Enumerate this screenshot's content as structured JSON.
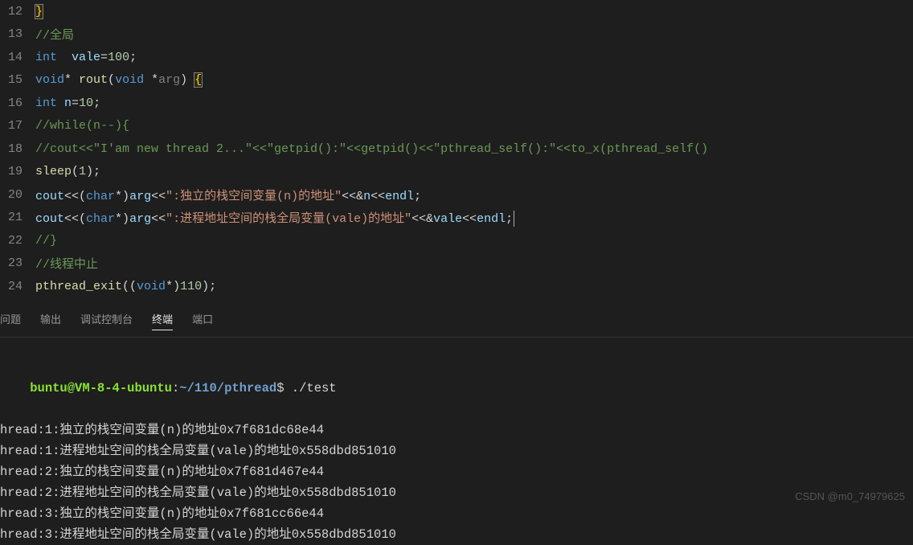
{
  "editor": {
    "lines": [
      {
        "num": "12",
        "tokens": [
          {
            "t": "}",
            "c": "tk-brace-hl"
          }
        ]
      },
      {
        "num": "13",
        "tokens": [
          {
            "t": "//全局",
            "c": "tk-cmt"
          }
        ]
      },
      {
        "num": "14",
        "tokens": [
          {
            "t": "int",
            "c": "tk-type"
          },
          {
            "t": "  ",
            "c": ""
          },
          {
            "t": "vale",
            "c": "tk-var"
          },
          {
            "t": "=",
            "c": "tk-pun"
          },
          {
            "t": "100",
            "c": "tk-num"
          },
          {
            "t": ";",
            "c": "tk-pun"
          }
        ]
      },
      {
        "num": "15",
        "tokens": [
          {
            "t": "void",
            "c": "tk-type"
          },
          {
            "t": "* ",
            "c": "tk-pun"
          },
          {
            "t": "rout",
            "c": "tk-fn"
          },
          {
            "t": "(",
            "c": "tk-pun"
          },
          {
            "t": "void",
            "c": "tk-type"
          },
          {
            "t": " *",
            "c": "tk-pun"
          },
          {
            "t": "arg",
            "c": "tk-param"
          },
          {
            "t": ") ",
            "c": "tk-pun"
          },
          {
            "t": "{",
            "c": "tk-brace-hl"
          }
        ]
      },
      {
        "num": "16",
        "tokens": [
          {
            "t": "int",
            "c": "tk-type"
          },
          {
            "t": " ",
            "c": ""
          },
          {
            "t": "n",
            "c": "tk-var"
          },
          {
            "t": "=",
            "c": "tk-pun"
          },
          {
            "t": "10",
            "c": "tk-num"
          },
          {
            "t": ";",
            "c": "tk-pun"
          }
        ]
      },
      {
        "num": "17",
        "tokens": [
          {
            "t": "//while(n--){",
            "c": "tk-cmt"
          }
        ]
      },
      {
        "num": "18",
        "tokens": [
          {
            "t": "//cout<<\"I'am new thread 2...\"<<\"getpid():\"<<getpid()<<\"pthread_self():\"<<to_x(pthread_self()",
            "c": "tk-cmt"
          }
        ]
      },
      {
        "num": "19",
        "tokens": [
          {
            "t": "sleep",
            "c": "tk-fn"
          },
          {
            "t": "(",
            "c": "tk-pun"
          },
          {
            "t": "1",
            "c": "tk-num"
          },
          {
            "t": ");",
            "c": "tk-pun"
          }
        ]
      },
      {
        "num": "20",
        "tokens": [
          {
            "t": "cout",
            "c": "tk-var"
          },
          {
            "t": "<<(",
            "c": "tk-pun"
          },
          {
            "t": "char",
            "c": "tk-type"
          },
          {
            "t": "*)",
            "c": "tk-pun"
          },
          {
            "t": "arg",
            "c": "tk-var"
          },
          {
            "t": "<<",
            "c": "tk-pun"
          },
          {
            "t": "\":独立的栈空间变量(n)的地址\"",
            "c": "tk-str"
          },
          {
            "t": "<<&",
            "c": "tk-pun"
          },
          {
            "t": "n",
            "c": "tk-var"
          },
          {
            "t": "<<",
            "c": "tk-pun"
          },
          {
            "t": "endl",
            "c": "tk-var"
          },
          {
            "t": ";",
            "c": "tk-pun"
          }
        ]
      },
      {
        "num": "21",
        "tokens": [
          {
            "t": "cout",
            "c": "tk-var"
          },
          {
            "t": "<<(",
            "c": "tk-pun"
          },
          {
            "t": "char",
            "c": "tk-type"
          },
          {
            "t": "*)",
            "c": "tk-pun"
          },
          {
            "t": "arg",
            "c": "tk-var"
          },
          {
            "t": "<<",
            "c": "tk-pun"
          },
          {
            "t": "\":进程地址空间的栈全局变量(vale)的地址\"",
            "c": "tk-str"
          },
          {
            "t": "<<&",
            "c": "tk-pun"
          },
          {
            "t": "vale",
            "c": "tk-var"
          },
          {
            "t": "<<",
            "c": "tk-pun"
          },
          {
            "t": "endl",
            "c": "tk-var"
          },
          {
            "t": ";",
            "c": "tk-pun"
          }
        ],
        "cursor": true
      },
      {
        "num": "22",
        "tokens": [
          {
            "t": "//}",
            "c": "tk-cmt"
          }
        ]
      },
      {
        "num": "23",
        "tokens": [
          {
            "t": "//线程中止",
            "c": "tk-cmt"
          }
        ]
      },
      {
        "num": "24",
        "tokens": [
          {
            "t": "pthread_exit",
            "c": "tk-fn"
          },
          {
            "t": "((",
            "c": "tk-pun"
          },
          {
            "t": "void",
            "c": "tk-type"
          },
          {
            "t": "*)",
            "c": "tk-pun"
          },
          {
            "t": "110",
            "c": "tk-num"
          },
          {
            "t": ");",
            "c": "tk-pun"
          }
        ]
      }
    ]
  },
  "panel": {
    "tabs": {
      "problems": "问题",
      "output": "输出",
      "debug_console": "调试控制台",
      "terminal": "终端",
      "ports": "端口"
    },
    "active_tab": "terminal"
  },
  "terminal": {
    "prompt": {
      "user_host": "buntu@VM-8-4-ubuntu",
      "colon": ":",
      "path": "~/110/pthread",
      "dollar": "$",
      "command": " ./test"
    },
    "output": [
      "hread:1:独立的栈空间变量(n)的地址0x7f681dc68e44",
      "hread:1:进程地址空间的栈全局变量(vale)的地址0x558dbd851010",
      "hread:2:独立的栈空间变量(n)的地址0x7f681d467e44",
      "hread:2:进程地址空间的栈全局变量(vale)的地址0x558dbd851010",
      "hread:3:独立的栈空间变量(n)的地址0x7f681cc66e44",
      "hread:3:进程地址空间的栈全局变量(vale)的地址0x558dbd851010"
    ]
  },
  "watermark": "CSDN @m0_74979625"
}
